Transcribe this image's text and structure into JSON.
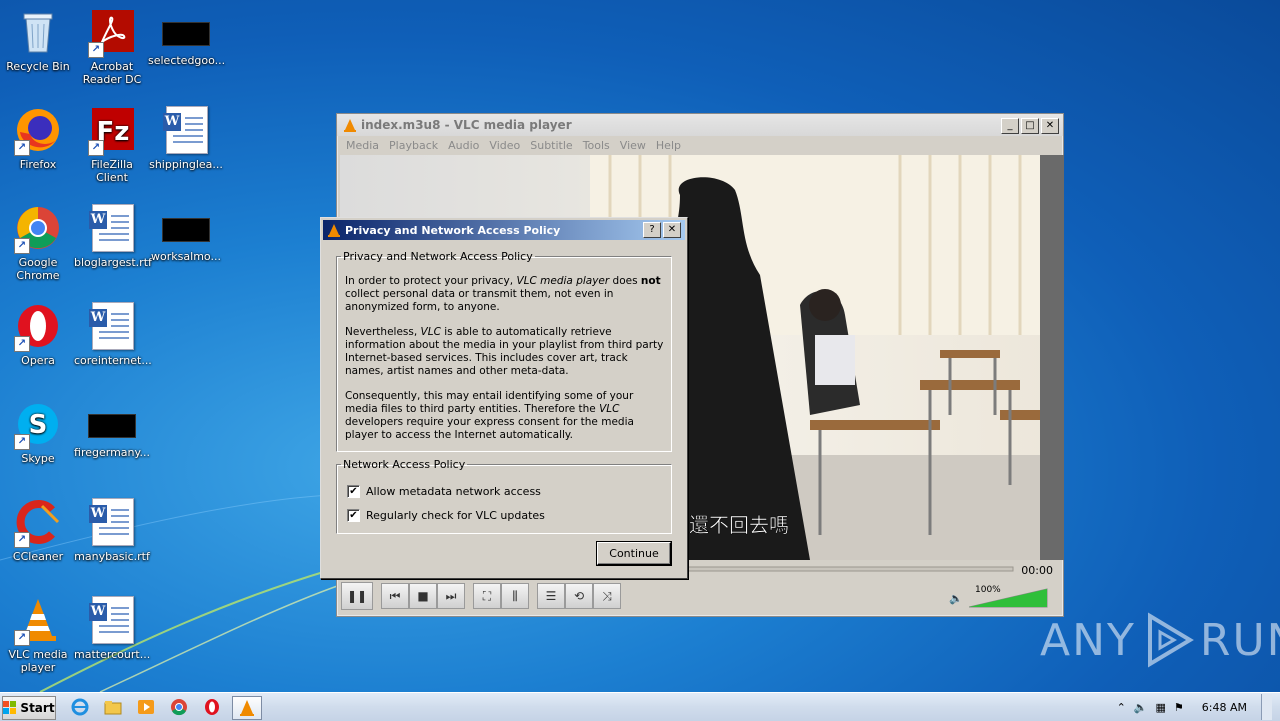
{
  "desktop": {
    "icons": [
      {
        "label": "Recycle Bin",
        "icon": "recycle-bin-icon"
      },
      {
        "label": "Acrobat Reader DC",
        "icon": "acrobat-icon"
      },
      {
        "label": "selectedgoo...",
        "icon": "black-file-icon"
      },
      {
        "label": "Firefox",
        "icon": "firefox-icon"
      },
      {
        "label": "FileZilla Client",
        "icon": "filezilla-icon"
      },
      {
        "label": "shippinglea...",
        "icon": "word-doc-icon"
      },
      {
        "label": "Google Chrome",
        "icon": "chrome-icon"
      },
      {
        "label": "bloglargest.rtf",
        "icon": "word-doc-icon"
      },
      {
        "label": "worksalmo...",
        "icon": "black-file-icon"
      },
      {
        "label": "Opera",
        "icon": "opera-icon"
      },
      {
        "label": "coreinternet...",
        "icon": "word-doc-icon"
      },
      {
        "label": "Skype",
        "icon": "skype-icon"
      },
      {
        "label": "firegermany...",
        "icon": "black-file-icon"
      },
      {
        "label": "CCleaner",
        "icon": "ccleaner-icon"
      },
      {
        "label": "manybasic.rtf",
        "icon": "word-doc-icon"
      },
      {
        "label": "VLC media player",
        "icon": "vlc-icon"
      },
      {
        "label": "mattercourt...",
        "icon": "word-doc-icon"
      }
    ]
  },
  "vlc": {
    "title": "index.m3u8 - VLC media player",
    "menu": [
      "Media",
      "Playback",
      "Audio",
      "Video",
      "Subtitle",
      "Tools",
      "View",
      "Help"
    ],
    "subtitle_text": "還不回去嗎",
    "time": "00:00",
    "volume": "100%",
    "volume_level": 1.0
  },
  "dialog": {
    "title": "Privacy and Network Access Policy",
    "help_btn": "?",
    "close_btn": "✕",
    "privacy_group": "Privacy and Network Access Policy",
    "p1_a": "In order to protect your privacy, ",
    "p1_b": "VLC media player",
    "p1_c": " does ",
    "p1_d": "not",
    "p1_e": " collect personal data or transmit them, not even in anonymized form, to anyone.",
    "p2_a": "Nevertheless, ",
    "p2_b": "VLC",
    "p2_c": " is able to automatically retrieve information about the media in your playlist from third party Internet-based services. This includes cover art, track names, artist names and other meta-data.",
    "p3_a": "Consequently, this may entail identifying some of your media files to third party entities. Therefore the ",
    "p3_b": "VLC",
    "p3_c": " developers require your express consent for the media player to access the Internet automatically.",
    "network_group": "Network Access Policy",
    "check1": "Allow metadata network access",
    "check2": "Regularly check for VLC updates",
    "check_mark": "✔",
    "continue": "Continue"
  },
  "watermark": {
    "left": "ANY",
    "right": "RUN"
  },
  "taskbar": {
    "start": "Start",
    "clock": "6:48 AM"
  }
}
